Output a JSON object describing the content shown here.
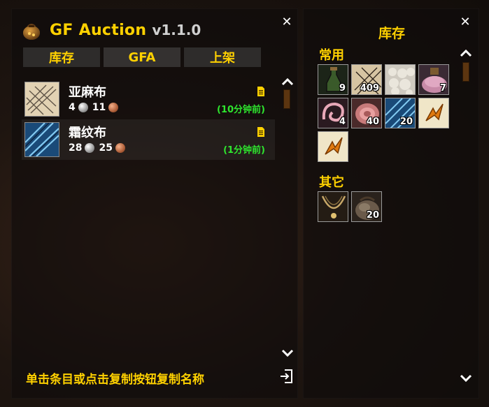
{
  "app": {
    "name": "GF Auction",
    "version": "v1.1.0"
  },
  "tabs": [
    {
      "label": "库存"
    },
    {
      "label": "GFA"
    },
    {
      "label": "上架"
    }
  ],
  "listings": [
    {
      "name": "亚麻布",
      "silver": "4",
      "copper": "11",
      "time": "(10分钟前)",
      "icon": "linen-cloth-icon",
      "selected": false
    },
    {
      "name": "霜纹布",
      "silver": "28",
      "copper": "25",
      "time": "(1分钟前)",
      "icon": "frostweave-cloth-icon",
      "selected": true
    }
  ],
  "hint": "单击条目或点击复制按钮复制名称",
  "inventory": {
    "title": "库存",
    "sections": [
      {
        "label": "常用",
        "items": [
          {
            "icon": "potion-bottle-icon",
            "count": "9"
          },
          {
            "icon": "linen-cloth-icon",
            "count": "409"
          },
          {
            "icon": "wool-cloth-icon",
            "count": ""
          },
          {
            "icon": "pink-bolt-icon",
            "count": "7"
          },
          {
            "icon": "pink-thread-icon",
            "count": "4"
          },
          {
            "icon": "silk-roll-icon",
            "count": "40"
          },
          {
            "icon": "frostweave-cloth-icon",
            "count": "20"
          },
          {
            "icon": "rune-scroll-icon",
            "count": ""
          },
          {
            "icon": "rune-scroll-icon",
            "count": ""
          }
        ]
      },
      {
        "label": "其它",
        "items": [
          {
            "icon": "necklace-icon",
            "count": ""
          },
          {
            "icon": "stone-sack-icon",
            "count": "20"
          }
        ]
      }
    ]
  }
}
